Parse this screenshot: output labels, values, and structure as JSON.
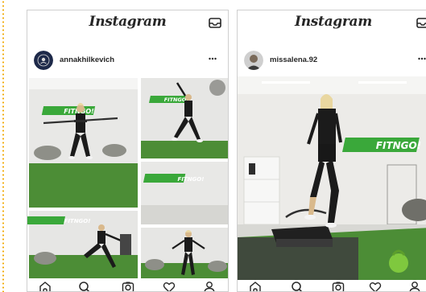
{
  "app": {
    "logo_text": "Instagram"
  },
  "brand_sign_text": "FITNGO!",
  "left_post": {
    "username": "annakhilkevich",
    "layout": "collage-5",
    "icons": [
      "inbox-icon",
      "more-icon"
    ]
  },
  "right_post": {
    "username": "missalena.92",
    "layout": "single-photo",
    "icons": [
      "inbox-icon",
      "more-icon"
    ]
  },
  "bottom_nav": {
    "items": [
      "home-icon",
      "search-icon",
      "camera-icon",
      "heart-icon",
      "profile-icon"
    ]
  },
  "colors": {
    "text": "#262626",
    "border": "#cfcfcf",
    "sign_green": "#3aa83a",
    "turf_green": "#4c8d36",
    "wall": "#e9e9e7",
    "dotted_edge": "#f0a800"
  }
}
